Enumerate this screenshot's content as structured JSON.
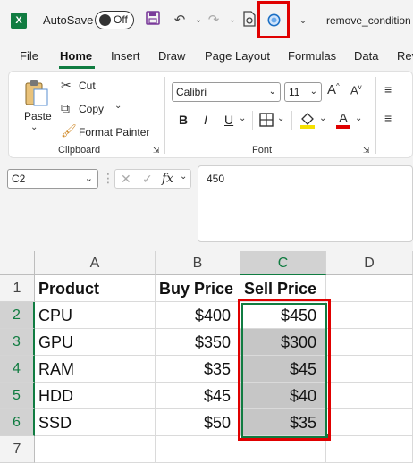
{
  "titlebar": {
    "app_logo": "X",
    "autosave_label": "AutoSave",
    "autosave_state": "Off",
    "filename": "remove_condition"
  },
  "tabs": [
    "File",
    "Home",
    "Insert",
    "Draw",
    "Page Layout",
    "Formulas",
    "Data",
    "Rev"
  ],
  "active_tab": "Home",
  "ribbon": {
    "clipboard": {
      "paste": "Paste",
      "cut": "Cut",
      "copy": "Copy",
      "format_painter": "Format Painter",
      "label": "Clipboard"
    },
    "font": {
      "font_name": "Calibri",
      "font_size": "11",
      "bold": "B",
      "italic": "I",
      "underline": "U",
      "label": "Font"
    }
  },
  "formula_bar": {
    "name_box": "C2",
    "fx": "fx",
    "formula": "450"
  },
  "columns": [
    "A",
    "B",
    "C",
    "D"
  ],
  "rows": [
    "1",
    "2",
    "3",
    "4",
    "5",
    "6",
    "7"
  ],
  "table": {
    "headers": [
      "Product",
      "Buy Price",
      "Sell Price"
    ],
    "data": [
      [
        "CPU",
        "$400",
        "$450"
      ],
      [
        "GPU",
        "$350",
        "$300"
      ],
      [
        "RAM",
        "$35",
        "$45"
      ],
      [
        "HDD",
        "$45",
        "$40"
      ],
      [
        "SSD",
        "$50",
        "$35"
      ]
    ]
  },
  "colors": {
    "excel_green": "#107c41",
    "highlight_red": "#e00000",
    "shaded_cell": "#c6c6c6"
  }
}
